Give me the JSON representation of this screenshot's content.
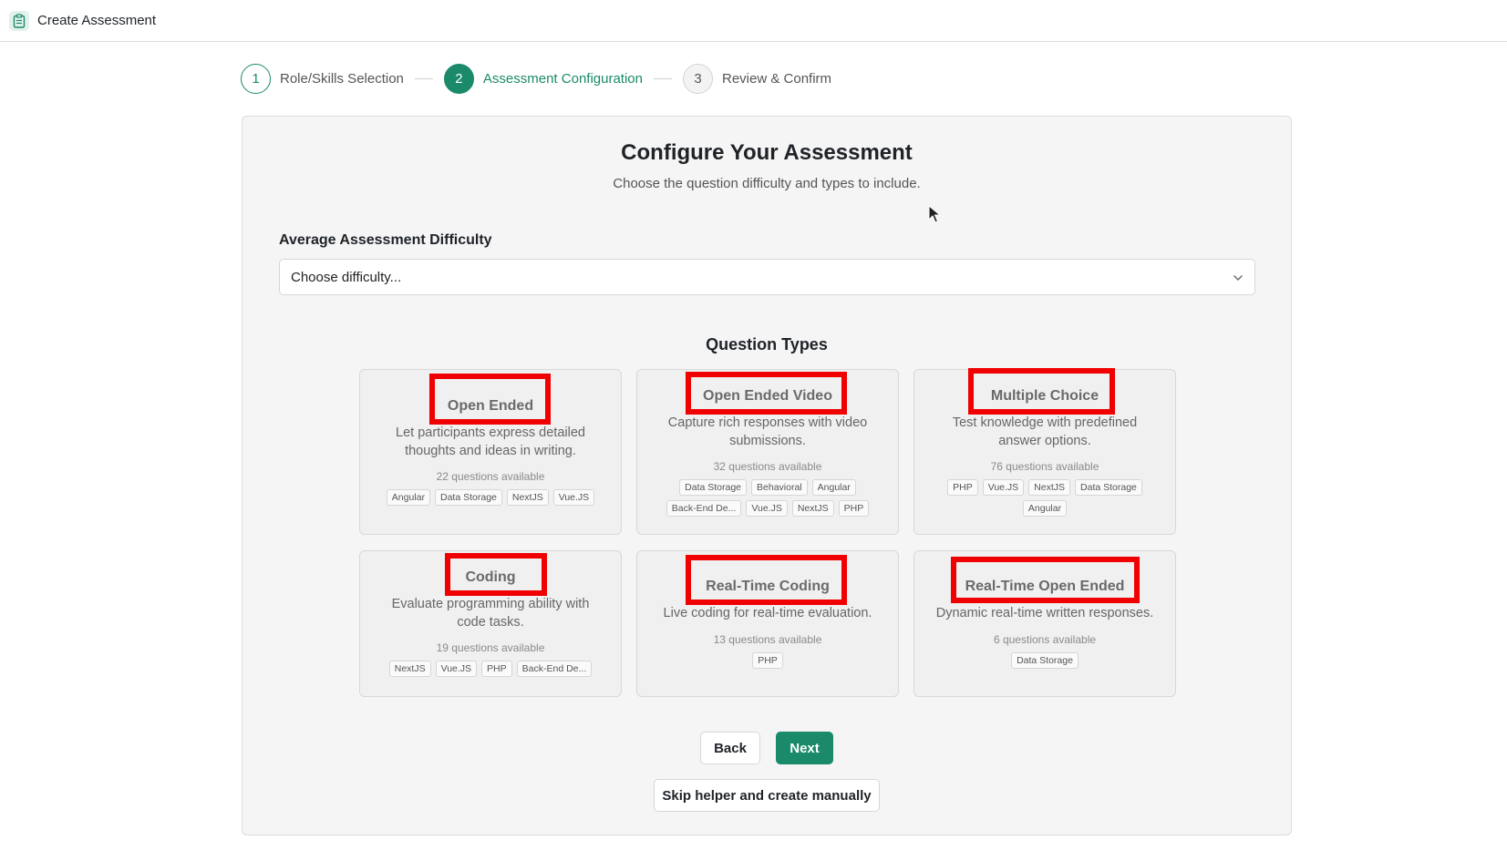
{
  "app": {
    "title": "Create Assessment",
    "icon": "clipboard-icon"
  },
  "stepper": {
    "steps": [
      {
        "number": "1",
        "label": "Role/Skills Selection",
        "state": "done"
      },
      {
        "number": "2",
        "label": "Assessment Configuration",
        "state": "active"
      },
      {
        "number": "3",
        "label": "Review & Confirm",
        "state": "todo"
      }
    ]
  },
  "main": {
    "title": "Configure Your Assessment",
    "subtitle": "Choose the question difficulty and types to include.",
    "difficulty": {
      "label": "Average Assessment Difficulty",
      "placeholder": "Choose difficulty..."
    },
    "question_types_title": "Question Types",
    "question_types": [
      {
        "name": "Open Ended",
        "description": "Let participants express detailed thoughts and ideas in writing.",
        "count": "22 questions available",
        "tags": [
          "Angular",
          "Data Storage",
          "NextJS",
          "Vue.JS"
        ]
      },
      {
        "name": "Open Ended Video",
        "description": "Capture rich responses with video submissions.",
        "count": "32 questions available",
        "tags": [
          "Data Storage",
          "Behavioral",
          "Angular",
          "Back-End De...",
          "Vue.JS",
          "NextJS",
          "PHP"
        ]
      },
      {
        "name": "Multiple Choice",
        "description": "Test knowledge with predefined answer options.",
        "count": "76 questions available",
        "tags": [
          "PHP",
          "Vue.JS",
          "NextJS",
          "Data Storage",
          "Angular"
        ]
      },
      {
        "name": "Coding",
        "description": "Evaluate programming ability with code tasks.",
        "count": "19 questions available",
        "tags": [
          "NextJS",
          "Vue.JS",
          "PHP",
          "Back-End De..."
        ]
      },
      {
        "name": "Real-Time Coding",
        "description": "Live coding for real-time evaluation.",
        "count": "13 questions available",
        "tags": [
          "PHP"
        ]
      },
      {
        "name": "Real-Time Open Ended",
        "description": "Dynamic real-time written responses.",
        "count": "6 questions available",
        "tags": [
          "Data Storage"
        ]
      }
    ],
    "buttons": {
      "back": "Back",
      "next": "Next",
      "skip": "Skip helper and create manually"
    }
  },
  "colors": {
    "accent": "#1a8a6a",
    "highlight": "#f00000"
  }
}
